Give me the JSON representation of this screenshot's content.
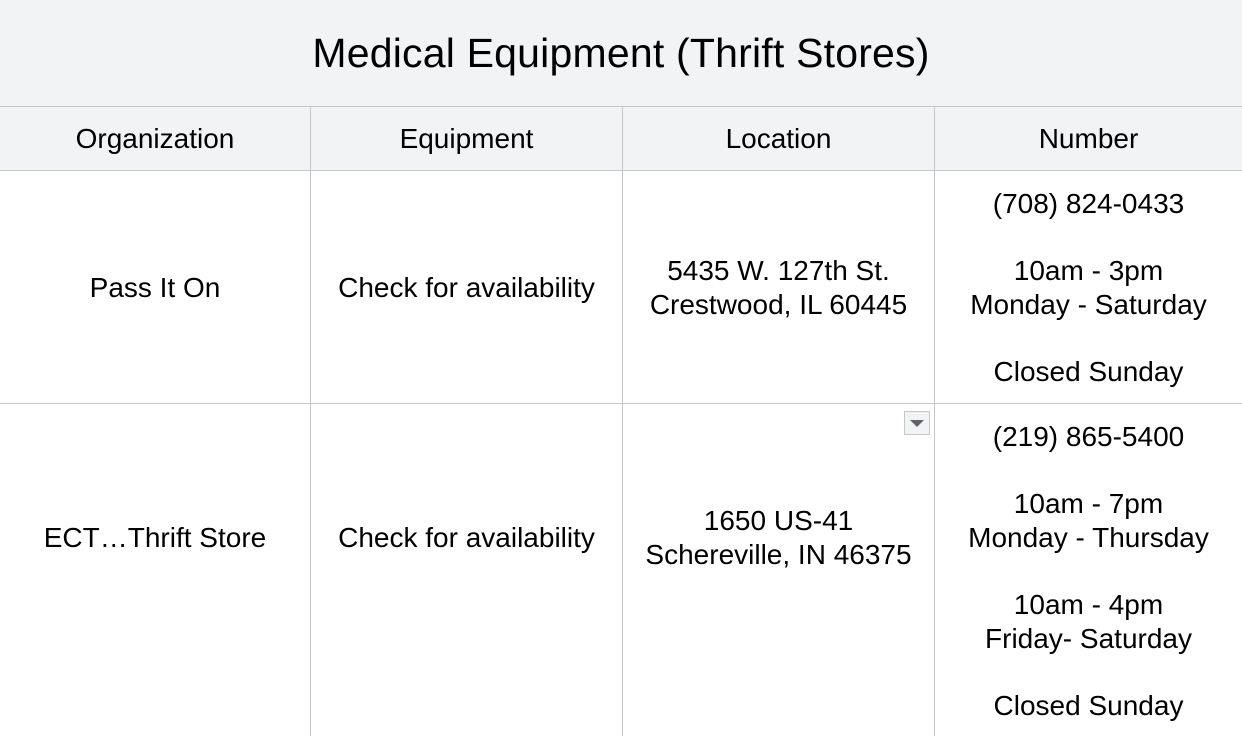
{
  "title": "Medical Equipment (Thrift Stores)",
  "columns": [
    "Organization",
    "Equipment",
    "Location",
    "Number"
  ],
  "rows": [
    {
      "organization": "Pass It On",
      "equipment": "Check for availability",
      "location_line1": "5435 W. 127th St.",
      "location_line2": "Crestwood, IL 60445",
      "phone": "(708) 824-0433",
      "hours1_time": "10am - 3pm",
      "hours1_days": "Monday - Saturday",
      "closed": "Closed Sunday"
    },
    {
      "organization": "ECT…Thrift Store",
      "equipment": "Check for availability",
      "location_line1": "1650 US-41",
      "location_line2": "Schereville, IN 46375",
      "phone": "(219) 865-5400",
      "hours1_time": "10am - 7pm",
      "hours1_days": "Monday - Thursday",
      "hours2_time": "10am - 4pm",
      "hours2_days": "Friday- Saturday",
      "closed": "Closed Sunday"
    }
  ],
  "icons": {
    "dropdown": "chevron-down-icon"
  },
  "colors": {
    "header_bg": "#f1f3f4",
    "grid": "#c7c7c7",
    "text": "#000000"
  }
}
